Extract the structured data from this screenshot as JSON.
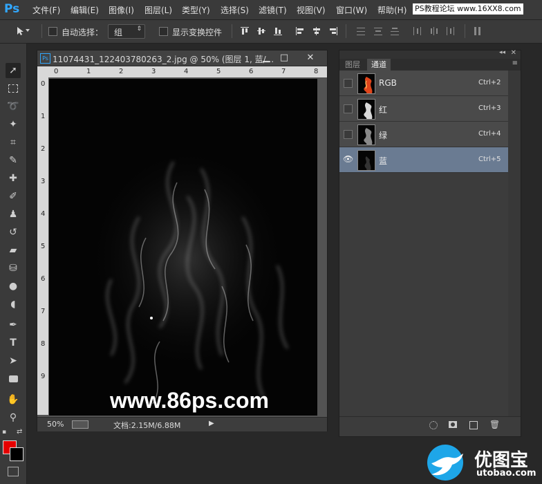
{
  "app": {
    "logo": "Ps"
  },
  "menu": [
    "文件(F)",
    "编辑(E)",
    "图像(I)",
    "图层(L)",
    "类型(Y)",
    "选择(S)",
    "滤镜(T)",
    "视图(V)",
    "窗口(W)",
    "帮助(H)"
  ],
  "site_tag": "PS教程论坛 www.16XX8.com",
  "options": {
    "auto_select_label": "自动选择：",
    "auto_select_value": "组",
    "show_transform_label": "显示变换控件"
  },
  "document": {
    "title": "11074431_122403780263_2.jpg @ 50% (图层 1, 蓝/...",
    "ruler_h": [
      "0",
      "1",
      "2",
      "3",
      "4",
      "5",
      "6",
      "7",
      "8"
    ],
    "ruler_v": [
      "0",
      "1",
      "2",
      "3",
      "4",
      "5",
      "6",
      "7",
      "8",
      "9"
    ],
    "watermark": "www.86ps.com",
    "zoom": "50%",
    "doc_size": "文档:2.15M/6.88M"
  },
  "panel": {
    "tabs": [
      "图层",
      "通道"
    ],
    "active_tab": "通道",
    "channels": [
      {
        "name": "RGB",
        "shortcut": "Ctrl+2",
        "visible": false,
        "selected": false
      },
      {
        "name": "红",
        "shortcut": "Ctrl+3",
        "visible": false,
        "selected": false
      },
      {
        "name": "绿",
        "shortcut": "Ctrl+4",
        "visible": false,
        "selected": false
      },
      {
        "name": "蓝",
        "shortcut": "Ctrl+5",
        "visible": true,
        "selected": true
      }
    ]
  },
  "colors": {
    "foreground": "#e60000",
    "background": "#000000",
    "accent": "#31a8ff",
    "selected_row": "#6a7b92"
  },
  "brand": {
    "name": "优图宝",
    "url": "utobao.com"
  }
}
